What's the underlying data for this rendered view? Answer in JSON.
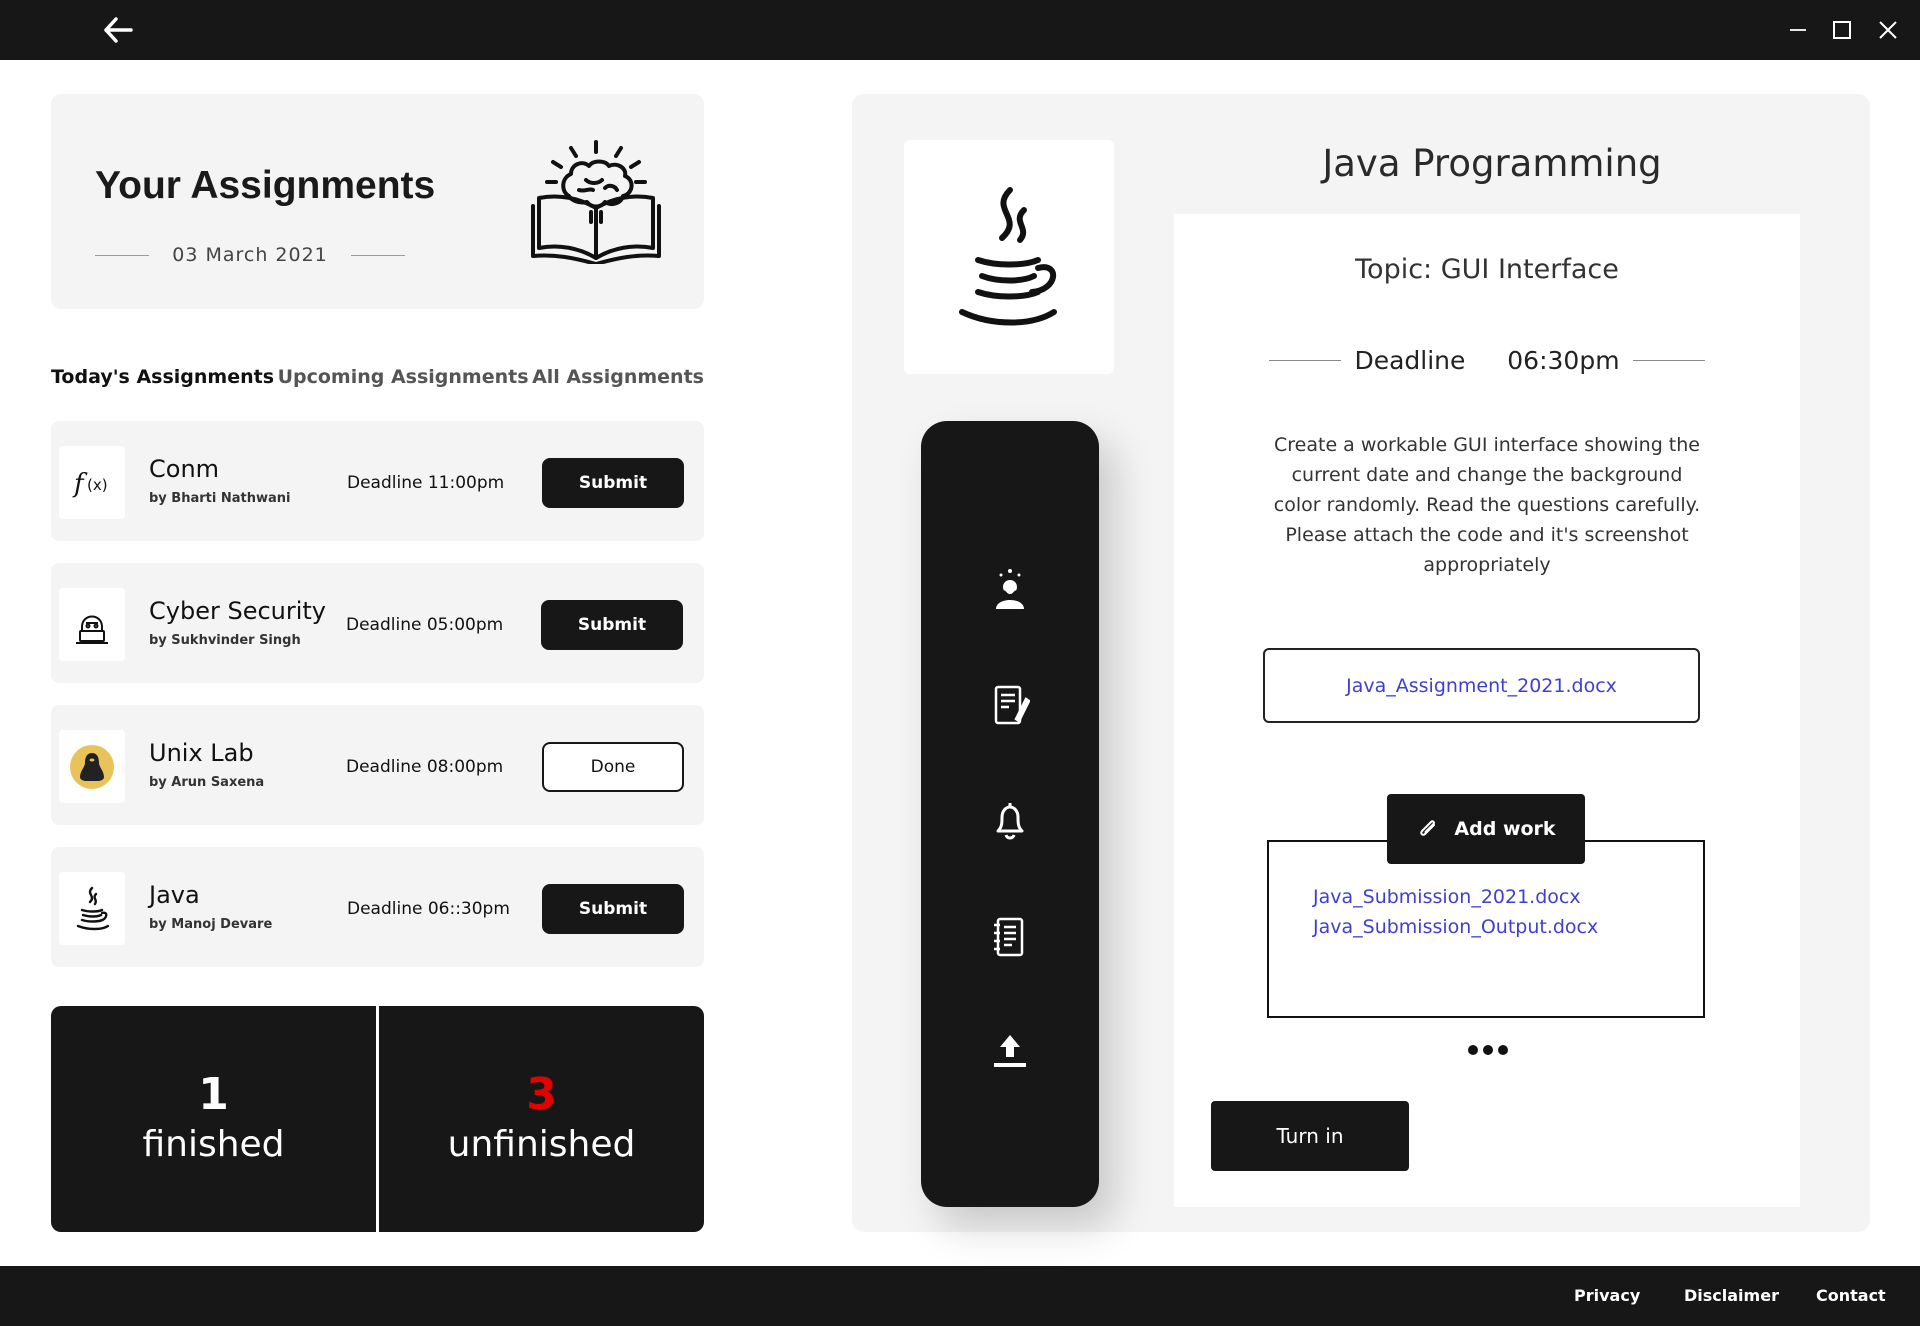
{
  "window": {
    "back_icon": "arrow-left-icon",
    "minimize_icon": "minimize-icon",
    "maximize_icon": "maximize-icon",
    "close_icon": "close-icon"
  },
  "hero": {
    "title": "Your Assignments",
    "date": "03 March 2021",
    "illustration": "brain-book-icon"
  },
  "tabs": [
    {
      "label": "Today's Assignments",
      "active": true
    },
    {
      "label": "Upcoming Assignments",
      "active": false
    },
    {
      "label": "All Assignments",
      "active": false
    }
  ],
  "assignments": [
    {
      "title": "Conm",
      "by": "by Bharti Nathwani",
      "deadline": "Deadline 11:00pm",
      "action": "Submit",
      "icon": "function-icon"
    },
    {
      "title": "Cyber Security",
      "by": "by Sukhvinder Singh",
      "deadline": "Deadline 05:00pm",
      "action": "Submit",
      "icon": "hacker-icon"
    },
    {
      "title": "Unix Lab",
      "by": "by Arun Saxena",
      "deadline": "Deadline 08:00pm",
      "action": "Done",
      "icon": "linux-penguin-icon"
    },
    {
      "title": "Java",
      "by": "by Manoj Devare",
      "deadline": "Deadline 06::30pm",
      "action": "Submit",
      "icon": "java-cup-icon"
    }
  ],
  "stats": {
    "finished_count": "1",
    "finished_label": "finished",
    "unfinished_count": "3",
    "unfinished_label": "unfinished",
    "unfinished_color": "#e20000"
  },
  "detail": {
    "title": "Java Programming",
    "logo": "java-cup-icon",
    "topic": "Topic:  GUI Interface",
    "deadline_label": "Deadline",
    "deadline_time": "06:30pm",
    "description": "Create a workable GUI interface showing the current date and change the background color randomly. Read the questions carefully. Please attach the code and it's screenshot appropriately",
    "attachment": "Java_Assignment_2021.docx",
    "add_work_label": "Add work",
    "add_work_icon": "paperclip-icon",
    "submissions": [
      "Java_Submission_2021.docx",
      "Java_Submission_Output.docx"
    ],
    "more_icon": "more-dots-icon",
    "turn_in_label": "Turn in",
    "link_color": "#3f3fd0"
  },
  "side_nav": [
    "thinking-person-icon",
    "assignment-sheet-icon",
    "bell-icon",
    "notebook-icon",
    "upload-icon"
  ],
  "footer": {
    "links": [
      "Privacy",
      "Disclaimer",
      "Contact"
    ]
  }
}
